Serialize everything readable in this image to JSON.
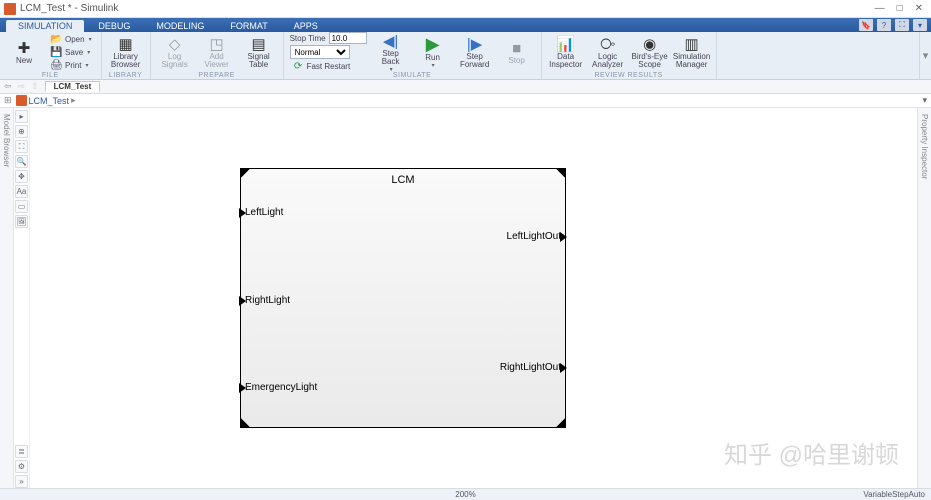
{
  "window": {
    "title": "LCM_Test * - Simulink"
  },
  "tabs": {
    "items": [
      "SIMULATION",
      "DEBUG",
      "MODELING",
      "FORMAT",
      "APPS"
    ],
    "active": 0
  },
  "toolstrip": {
    "file": {
      "new": "New",
      "open": "Open",
      "save": "Save",
      "print": "Print",
      "label": "FILE"
    },
    "library": {
      "browser": "Library\nBrowser",
      "label": "LIBRARY"
    },
    "prepare": {
      "log": "Log\nSignals",
      "viewer": "Add\nViewer",
      "table": "Signal\nTable",
      "label": "PREPARE"
    },
    "simulate": {
      "stoptime_label": "Stop Time",
      "stoptime_value": "10.0",
      "mode": "Normal",
      "fast": "Fast Restart",
      "stepback": "Step\nBack",
      "run": "Run",
      "stepfwd": "Step\nForward",
      "stop": "Stop",
      "label": "SIMULATE"
    },
    "review": {
      "di": "Data\nInspector",
      "la": "Logic\nAnalyzer",
      "be": "Bird's-Eye\nScope",
      "sm": "Simulation\nManager",
      "label": "REVIEW RESULTS"
    }
  },
  "subtoolbar": {
    "doc": "LCM_Test"
  },
  "breadcrumb": {
    "root": "LCM_Test"
  },
  "side": {
    "left": "Model Browser",
    "right": "Property Inspector"
  },
  "block": {
    "title": "LCM",
    "inports": [
      "LeftLight",
      "RightLight",
      "EmergencyLight"
    ],
    "outports": [
      "LeftLightOut",
      "RightLightOut"
    ]
  },
  "status": {
    "zoom": "200%",
    "solver": "VariableStepAuto"
  },
  "watermark": "知乎 @哈里谢顿"
}
